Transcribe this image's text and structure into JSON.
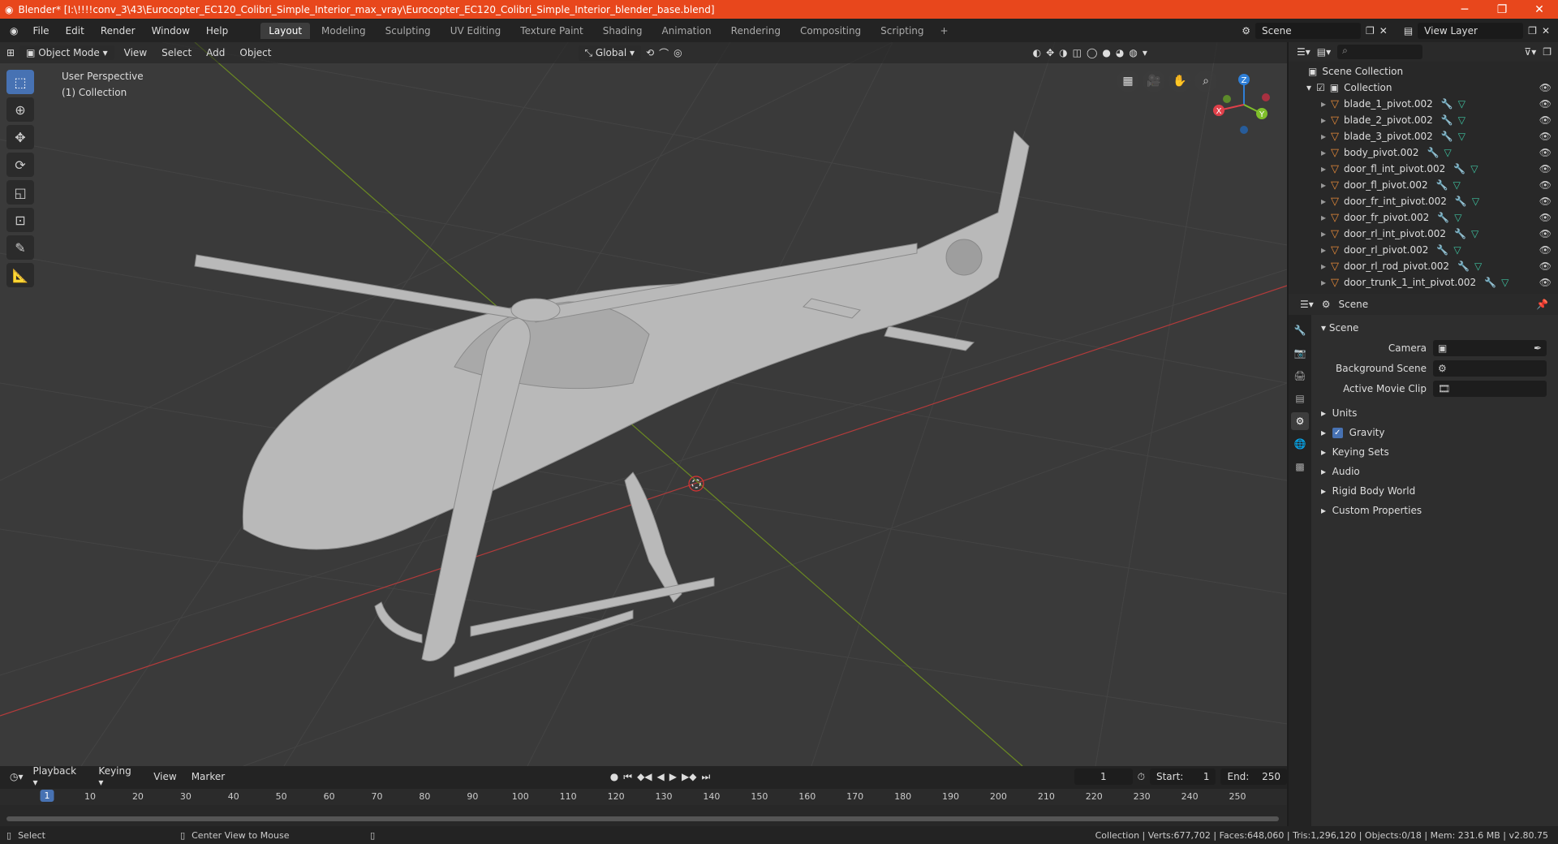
{
  "title": "Blender* [I:\\!!!!conv_3\\43\\Eurocopter_EC120_Colibri_Simple_Interior_max_vray\\Eurocopter_EC120_Colibri_Simple_Interior_blender_base.blend]",
  "menu": [
    "File",
    "Edit",
    "Render",
    "Window",
    "Help"
  ],
  "workspaces": [
    "Layout",
    "Modeling",
    "Sculpting",
    "UV Editing",
    "Texture Paint",
    "Shading",
    "Animation",
    "Rendering",
    "Compositing",
    "Scripting"
  ],
  "scene_field": "Scene",
  "view_layer_field": "View Layer",
  "viewport": {
    "mode": "Object Mode",
    "menus": [
      "View",
      "Select",
      "Add",
      "Object"
    ],
    "orientation": "Global",
    "info_line1": "User Perspective",
    "info_line2": "(1) Collection"
  },
  "gizmo": {
    "x": "X",
    "y": "Y",
    "z": "Z"
  },
  "outliner": {
    "scene_collection": "Scene Collection",
    "collection": "Collection",
    "items": [
      "blade_1_pivot.002",
      "blade_2_pivot.002",
      "blade_3_pivot.002",
      "body_pivot.002",
      "door_fl_int_pivot.002",
      "door_fl_pivot.002",
      "door_fr_int_pivot.002",
      "door_fr_pivot.002",
      "door_rl_int_pivot.002",
      "door_rl_pivot.002",
      "door_rl_rod_pivot.002",
      "door_trunk_1_int_pivot.002"
    ]
  },
  "properties": {
    "header": "Scene",
    "panel": "Scene",
    "camera_label": "Camera",
    "bg_scene_label": "Background Scene",
    "movie_clip_label": "Active Movie Clip",
    "subpanels": [
      "Units",
      "Gravity",
      "Keying Sets",
      "Audio",
      "Rigid Body World",
      "Custom Properties"
    ]
  },
  "timeline": {
    "menus": [
      "Playback",
      "Keying",
      "View",
      "Marker"
    ],
    "current_frame": "1",
    "start_label": "Start:",
    "start": "1",
    "end_label": "End:",
    "end": "250",
    "ticks": [
      "1",
      "10",
      "20",
      "30",
      "40",
      "50",
      "60",
      "70",
      "80",
      "90",
      "100",
      "110",
      "120",
      "130",
      "140",
      "150",
      "160",
      "170",
      "180",
      "190",
      "200",
      "210",
      "220",
      "230",
      "240",
      "250"
    ]
  },
  "status": {
    "left1": "Select",
    "left2": "Center View to Mouse",
    "right": "Collection | Verts:677,702 | Faces:648,060 | Tris:1,296,120 | Objects:0/18 | Mem: 231.6 MB | v2.80.75"
  }
}
